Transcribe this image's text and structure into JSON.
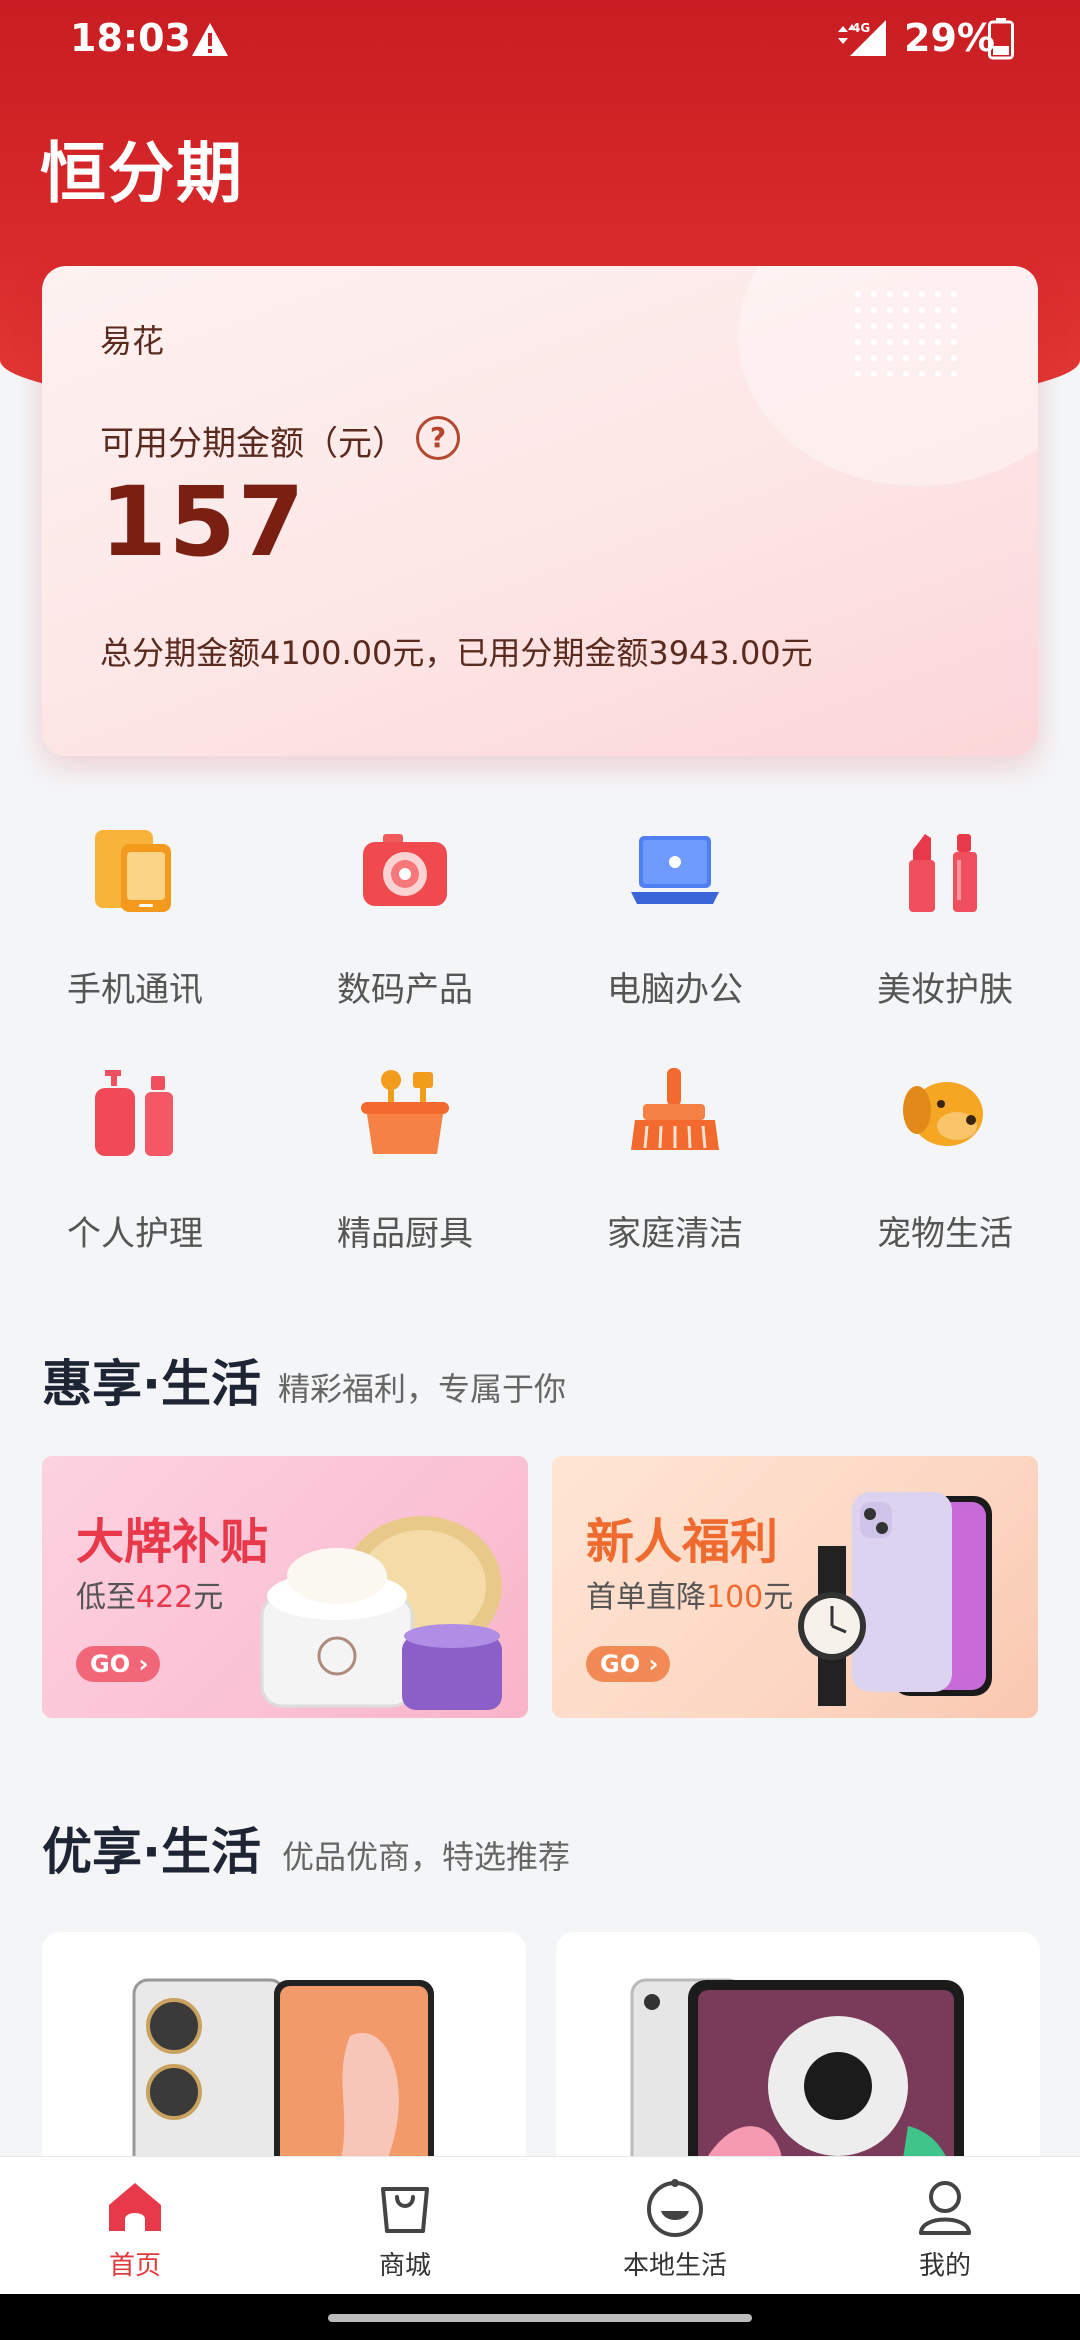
{
  "status": {
    "time": "18:03",
    "network": "4G",
    "battery": "29%"
  },
  "brand": "恒分期",
  "card": {
    "label": "易花",
    "amount_label": "可用分期金额（元）",
    "help": "?",
    "amount": "157",
    "total_text": "总分期金额4100.00元，已用分期金额3943.00元"
  },
  "categories": [
    {
      "label": "手机通讯",
      "icon": "phone-icon"
    },
    {
      "label": "数码产品",
      "icon": "camera-icon"
    },
    {
      "label": "电脑办公",
      "icon": "laptop-icon"
    },
    {
      "label": "美妆护肤",
      "icon": "lipstick-icon"
    },
    {
      "label": "个人护理",
      "icon": "lotion-icon"
    },
    {
      "label": "精品厨具",
      "icon": "kitchen-icon"
    },
    {
      "label": "家庭清洁",
      "icon": "broom-icon"
    },
    {
      "label": "宠物生活",
      "icon": "dog-icon"
    }
  ],
  "section1": {
    "title": "惠享·生活",
    "subtitle": "精彩福利，专属于你"
  },
  "promos": [
    {
      "title": "大牌补贴",
      "sub_prefix": "低至",
      "sub_value": "422",
      "sub_suffix": "元",
      "go": "GO",
      "accent": "#e8394a"
    },
    {
      "title": "新人福利",
      "sub_prefix": "首单直降",
      "sub_value": "100",
      "sub_suffix": "元",
      "go": "GO",
      "accent": "#ef6a2e"
    }
  ],
  "section2": {
    "title": "优享·生活",
    "subtitle": "优品优商，特选推荐"
  },
  "tabs": [
    {
      "label": "首页",
      "icon": "home-icon",
      "active": true
    },
    {
      "label": "商城",
      "icon": "shopping-bag-icon",
      "active": false
    },
    {
      "label": "本地生活",
      "icon": "smile-icon",
      "active": false
    },
    {
      "label": "我的",
      "icon": "person-icon",
      "active": false
    }
  ],
  "colors": {
    "brand_red": "#d92a2b",
    "amount": "#7a2012",
    "active_tab": "#e23a3a"
  }
}
